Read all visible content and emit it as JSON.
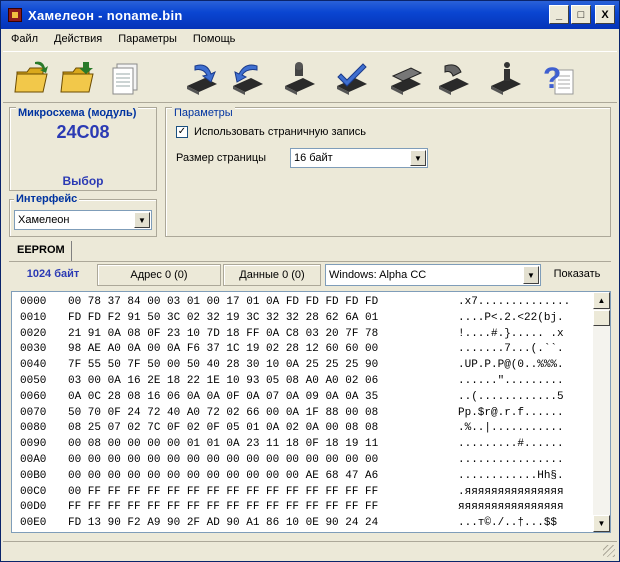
{
  "window": {
    "title": "Хамелеон - noname.bin"
  },
  "window_buttons": {
    "minimize": "_",
    "maximize": "□",
    "close": "X"
  },
  "menu": [
    "Файл",
    "Действия",
    "Параметры",
    "Помощь"
  ],
  "toolbar": {
    "icons": [
      "open-folder-icon",
      "save-folder-icon",
      "document-icon",
      "read-chip-icon",
      "write-chip-icon",
      "erase-chip-icon",
      "verify-chip-icon",
      "chip-op-icon",
      "chip-op2-icon",
      "chip-info-icon",
      "help-icon"
    ],
    "help_glyph": "?"
  },
  "chip": {
    "label": "Микросхема (модуль)",
    "name": "24C08",
    "select_label": "Выбор"
  },
  "interface": {
    "label": "Интерфейс",
    "value": "Хамелеон"
  },
  "params": {
    "label": "Параметры",
    "use_page_write": "Использовать страничную запись",
    "use_page_write_checked": true,
    "page_size_label": "Размер страницы",
    "page_size_value": "16 байт"
  },
  "tab": {
    "label": "EEPROM"
  },
  "info": {
    "size": "1024 байт",
    "address": "Адрес 0 (0)",
    "data": "Данные 0 (0)",
    "encoding": "Windows: Alpha CC",
    "show_label": "Показать"
  },
  "hex_rows": [
    {
      "addr": "0000",
      "bytes": "00 78 37 84 00 03 01 00 17 01 0A FD FD FD FD FD",
      "ascii": ".x7.............."
    },
    {
      "addr": "0010",
      "bytes": "FD FD F2 91 50 3C 02 32 19 3C 32 32 28 62 6A 01",
      "ascii": "....P<.2.<22(bj."
    },
    {
      "addr": "0020",
      "bytes": "21 91 0A 08 0F 23 10 7D 18 FF 0A C8 03 20 7F 78",
      "ascii": "!....#.}..... .x"
    },
    {
      "addr": "0030",
      "bytes": "98 AE A0 0A 00 0A F6 37 1C 19 02 28 12 60 60 00",
      "ascii": ".......7...(.``."
    },
    {
      "addr": "0040",
      "bytes": "7F 55 50 7F 50 00 50 40 28 30 10 0A 25 25 25 90",
      "ascii": ".UP.P.P@(0..%%%."
    },
    {
      "addr": "0050",
      "bytes": "03 00 0A 16 2E 18 22 1E 10 93 05 08 A0 A0 02 06",
      "ascii": "......\"........."
    },
    {
      "addr": "0060",
      "bytes": "0A 0C 28 08 16 06 0A 0A 0F 0A 07 0A 09 0A 0A 35",
      "ascii": "..(............5"
    },
    {
      "addr": "0070",
      "bytes": "50 70 0F 24 72 40 A0 72 02 66 00 0A 1F 88 00 08",
      "ascii": "Pp.$r@.r.f......"
    },
    {
      "addr": "0080",
      "bytes": "08 25 07 02 7C 0F 02 0F 05 01 0A 02 0A 00 08 08",
      "ascii": ".%..|..........."
    },
    {
      "addr": "0090",
      "bytes": "00 08 00 00 00 00 01 01 0A 23 11 18 0F 18 19 11",
      "ascii": ".........#......"
    },
    {
      "addr": "00A0",
      "bytes": "00 00 00 00 00 00 00 00 00 00 00 00 00 00 00 00",
      "ascii": "................"
    },
    {
      "addr": "00B0",
      "bytes": "00 00 00 00 00 00 00 00 00 00 00 00 AE 68 47 A6",
      "ascii": "............Hh§."
    },
    {
      "addr": "00C0",
      "bytes": "00 FF FF FF FF FF FF FF FF FF FF FF FF FF FF FF",
      "ascii": ".яяяяяяяяяяяяяяя"
    },
    {
      "addr": "00D0",
      "bytes": "FF FF FF FF FF FF FF FF FF FF FF FF FF FF FF FF",
      "ascii": "яяяяяяяяяяяяяяяя"
    },
    {
      "addr": "00E0",
      "bytes": "FD 13 90 F2 A9 90 2F AD 90 A1 86 10 0E 90 24 24",
      "ascii": "...т©./­..†...$$"
    }
  ],
  "colors": {
    "title_bar": "#0a46d2",
    "accent_text": "#2b3ab4",
    "group_label": "#0033a0",
    "window_bg": "#ece9d8"
  }
}
